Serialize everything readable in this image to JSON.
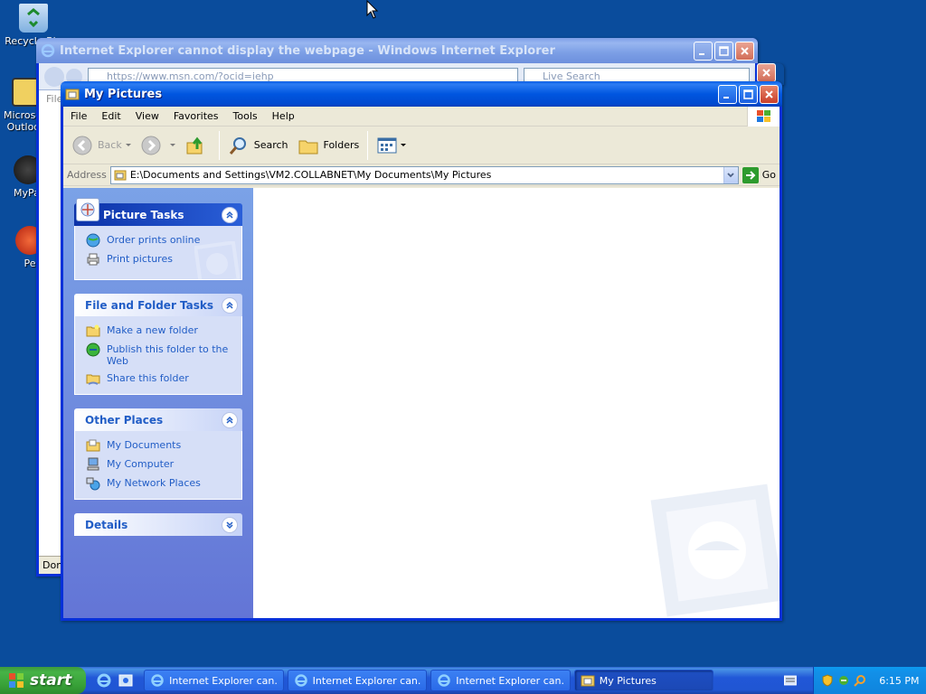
{
  "desktop": {
    "icons": [
      {
        "label": "Recycle Bin",
        "icon": "recycle-bin-icon"
      },
      {
        "label": "Microsoft Outlook",
        "icon": "outlook-icon"
      },
      {
        "label": "MyPal",
        "icon": "mypal-icon"
      },
      {
        "label": "Pe",
        "icon": "app-icon"
      }
    ]
  },
  "ie_window": {
    "title": "Internet Explorer cannot display the webpage - Windows Internet Explorer",
    "address": "https://www.msn.com/?ocid=iehp",
    "search_placeholder": "Live Search",
    "menu_hint": "File",
    "status": "Done"
  },
  "mp_window": {
    "title": "My Pictures",
    "menu": [
      "File",
      "Edit",
      "View",
      "Favorites",
      "Tools",
      "Help"
    ],
    "toolbar": {
      "back": "Back",
      "search": "Search",
      "folders": "Folders"
    },
    "address": {
      "label": "Address",
      "value": "E:\\Documents and Settings\\VM2.COLLABNET\\My Documents\\My Pictures",
      "go": "Go"
    },
    "taskpane": {
      "picture_tasks": {
        "title": "Picture Tasks",
        "links": [
          "Order prints online",
          "Print pictures"
        ]
      },
      "file_folder_tasks": {
        "title": "File and Folder Tasks",
        "links": [
          "Make a new folder",
          "Publish this folder to the Web",
          "Share this folder"
        ]
      },
      "other_places": {
        "title": "Other Places",
        "links": [
          "My Documents",
          "My Computer",
          "My Network Places"
        ]
      },
      "details": {
        "title": "Details"
      }
    }
  },
  "taskbar": {
    "start": "start",
    "tasks": [
      {
        "label": "Internet Explorer can...",
        "icon": "ie-icon"
      },
      {
        "label": "Internet Explorer can...",
        "icon": "ie-icon"
      },
      {
        "label": "Internet Explorer can...",
        "icon": "ie-icon"
      },
      {
        "label": "My Pictures",
        "icon": "folder-icon",
        "active": true
      }
    ],
    "clock": "6:15 PM"
  },
  "colors": {
    "desktop": "#0a4c9c",
    "titlebar": "#0054e3",
    "taskpane_link": "#215dc6",
    "start_green": "#3c9a3c"
  }
}
